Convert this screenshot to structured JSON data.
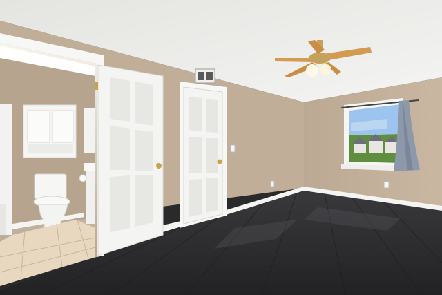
{
  "scene": {
    "description_name": "empty-bedroom-with-ensuite",
    "colors": {
      "wall": "#c3b19c",
      "wall_shadow": "#ad9c87",
      "ceiling": "#ededeb",
      "floor": "#2e2e30",
      "floor_highlight": "#4a4a4e",
      "door": "#f4f4f2",
      "door_panel_shadow": "#dcdcd8",
      "trim": "#f7f7f5",
      "tile": "#ecdcc4",
      "tile_grout": "#cbb9a0",
      "bath_wall": "#b7a48e",
      "sky": "#9cc4ee",
      "grass": "#5f8e3f",
      "curtain": "#8c98a8",
      "fan_blade": "#d39a52",
      "fan_metal": "#c6a15c",
      "fan_light": "#fff8e8"
    },
    "icons": {
      "fan": "ceiling-fan-icon",
      "vent": "air-vent-icon",
      "outlet": "power-outlet-icon",
      "switch": "light-switch-icon"
    }
  }
}
